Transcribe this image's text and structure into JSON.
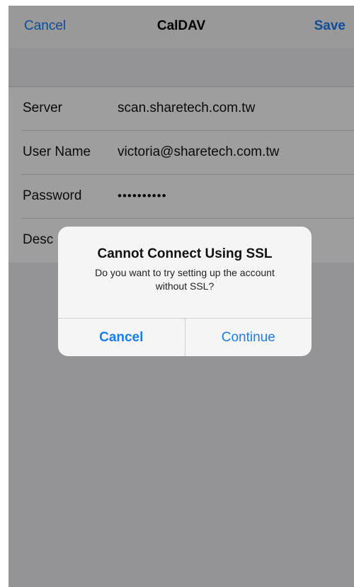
{
  "navbar": {
    "cancel_label": "Cancel",
    "title": "CalDAV",
    "save_label": "Save"
  },
  "form": {
    "rows": [
      {
        "label": "Server",
        "value": "scan.sharetech.com.tw"
      },
      {
        "label": "User Name",
        "value": "victoria@sharetech.com.tw"
      },
      {
        "label": "Password",
        "value": "••••••••••"
      },
      {
        "label": "Desc",
        "value": ""
      }
    ]
  },
  "alert": {
    "title": "Cannot Connect Using SSL",
    "message": "Do you want to try setting up the account without SSL?",
    "cancel_label": "Cancel",
    "continue_label": "Continue"
  },
  "colors": {
    "accent": "#1a7cf5",
    "background": "#efeff4",
    "overlay": "rgba(0,0,0,0.38)"
  }
}
